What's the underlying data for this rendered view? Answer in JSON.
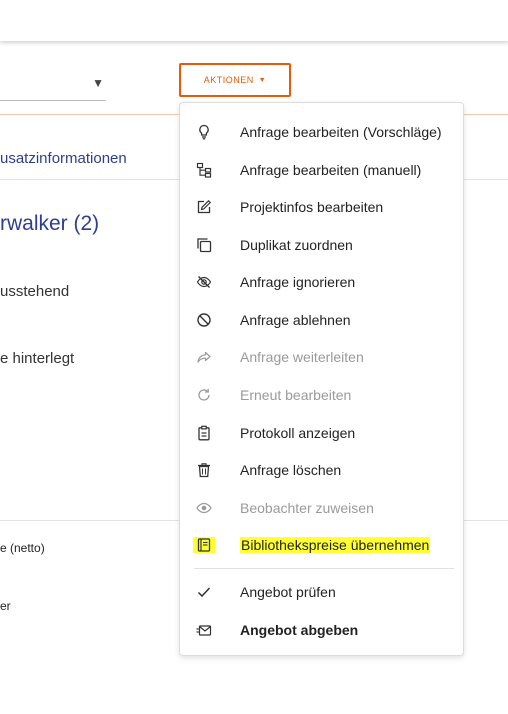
{
  "toolbar": {
    "actions_label": "AKTIONEN",
    "select_value": ""
  },
  "tabs": {
    "zusatz": "usatzinformationen"
  },
  "main": {
    "heading": "rwalker  (2)",
    "status_text": "usstehend",
    "hinterlegt_text": "e hinterlegt",
    "netto_text": "e (netto)",
    "er_text": "er"
  },
  "menu": {
    "items": [
      {
        "label": "Anfrage bearbeiten (Vorschläge)",
        "icon": "lightbulb-icon",
        "disabled": false
      },
      {
        "label": "Anfrage bearbeiten (manuell)",
        "icon": "tree-icon",
        "disabled": false
      },
      {
        "label": "Projektinfos bearbeiten",
        "icon": "edit-icon",
        "disabled": false
      },
      {
        "label": "Duplikat zuordnen",
        "icon": "copy-icon",
        "disabled": false
      },
      {
        "label": "Anfrage ignorieren",
        "icon": "eye-off-icon",
        "disabled": false
      },
      {
        "label": "Anfrage ablehnen",
        "icon": "block-icon",
        "disabled": false
      },
      {
        "label": "Anfrage weiterleiten",
        "icon": "forward-icon",
        "disabled": true
      },
      {
        "label": "Erneut bearbeiten",
        "icon": "redo-icon",
        "disabled": true
      },
      {
        "label": "Protokoll anzeigen",
        "icon": "clipboard-icon",
        "disabled": false
      },
      {
        "label": "Anfrage löschen",
        "icon": "trash-icon",
        "disabled": false
      },
      {
        "label": "Beobachter zuweisen",
        "icon": "eye-icon",
        "disabled": true
      },
      {
        "label": "Bibliothekspreise übernehmen",
        "icon": "book-icon",
        "disabled": false,
        "highlighted": true
      },
      {
        "label": "Angebot prüfen",
        "icon": "check-icon",
        "disabled": false
      },
      {
        "label": "Angebot abgeben",
        "icon": "send-mail-icon",
        "disabled": false,
        "bold": true
      }
    ]
  },
  "colors": {
    "accent": "#e8590c",
    "link": "#2e3f8f",
    "highlight": "#ffff33"
  }
}
